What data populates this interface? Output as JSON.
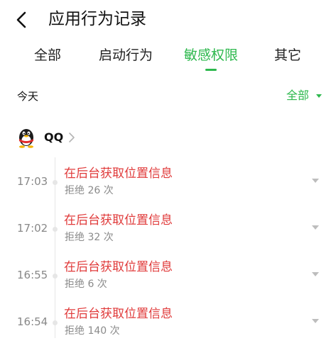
{
  "header": {
    "back_icon": "chevron-left-icon",
    "title": "应用行为记录"
  },
  "tabs": [
    {
      "label": "全部",
      "active": false
    },
    {
      "label": "启动行为",
      "active": false
    },
    {
      "label": "敏感权限",
      "active": true
    },
    {
      "label": "其它",
      "active": false
    }
  ],
  "section": {
    "label": "今天",
    "filter_label": "全部"
  },
  "app": {
    "icon": "qq-penguin-icon",
    "name": "QQ"
  },
  "records": [
    {
      "time": "17:03",
      "title": "在后台获取位置信息",
      "sub": "拒绝 26 次"
    },
    {
      "time": "17:02",
      "title": "在后台获取位置信息",
      "sub": "拒绝 32 次"
    },
    {
      "time": "16:55",
      "title": "在后台获取位置信息",
      "sub": "拒绝 6 次"
    },
    {
      "time": "16:54",
      "title": "在后台获取位置信息",
      "sub": "拒绝 140 次"
    }
  ],
  "colors": {
    "accent": "#2db84d",
    "alert": "#e03a3a",
    "muted": "#888888"
  }
}
